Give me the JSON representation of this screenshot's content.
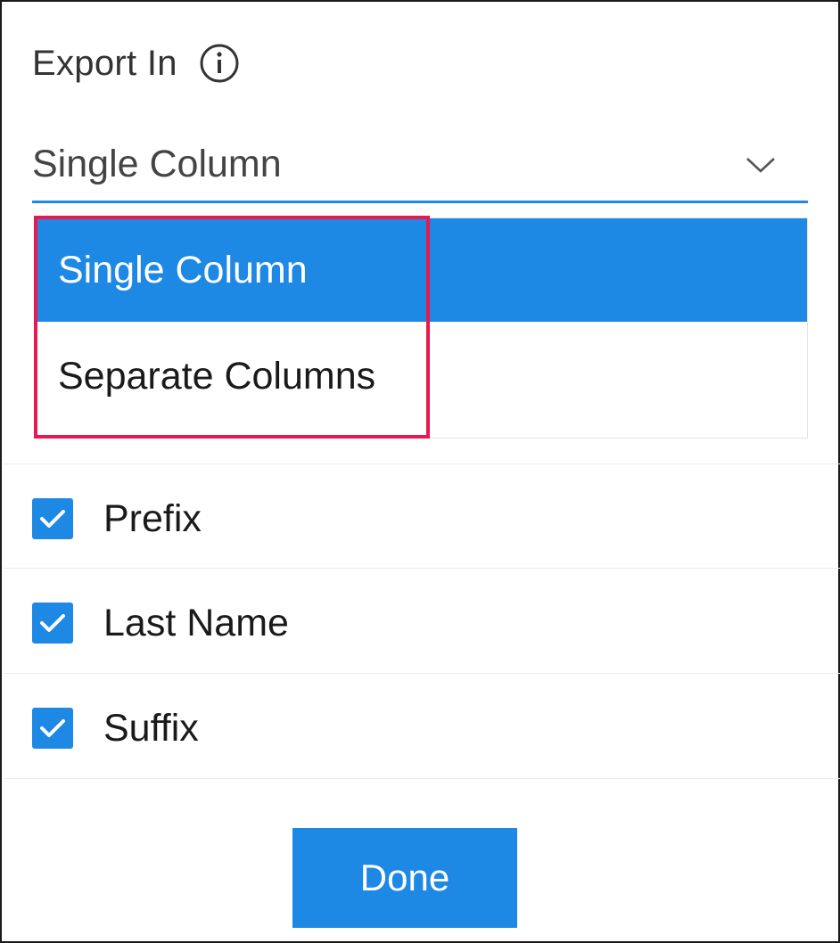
{
  "export": {
    "title": "Export In",
    "info_icon": "info-circle-icon",
    "selected_value": "Single Column",
    "dropdown_icon": "chevron-down-icon",
    "options": [
      {
        "label": "Single Column",
        "selected": true
      },
      {
        "label": "Separate Columns",
        "selected": false
      }
    ]
  },
  "fields": [
    {
      "label": "Prefix",
      "checked": true
    },
    {
      "label": "Last Name",
      "checked": true
    },
    {
      "label": "Suffix",
      "checked": true
    }
  ],
  "actions": {
    "done_label": "Done"
  },
  "colors": {
    "accent": "#1e88e5",
    "highlight": "#e8194f",
    "text": "#1a1a1a",
    "muted_text": "#444444"
  }
}
